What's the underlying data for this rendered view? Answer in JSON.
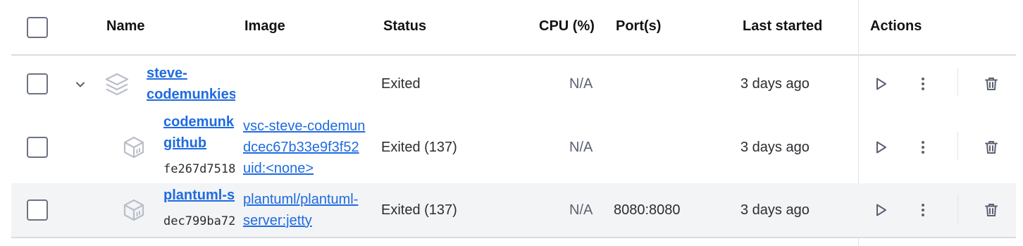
{
  "header": {
    "name": "Name",
    "image": "Image",
    "status": "Status",
    "cpu": "CPU (%)",
    "ports": "Port(s)",
    "last_started": "Last started",
    "actions": "Actions"
  },
  "rows": [
    {
      "name": "steve-codemunkies",
      "name_line1": "steve-",
      "name_line2": "codemunkies",
      "status": "Exited",
      "cpu": "N/A",
      "ports": "",
      "last_started": "3 days ago"
    },
    {
      "name_line1": "codemunk",
      "name_line2": "github",
      "id": "fe267d7518",
      "image_line1": "vsc-steve-codemun",
      "image_line2": "dcec67b33e9f3f52",
      "image_line3": "uid:<none>",
      "status": "Exited (137)",
      "cpu": "N/A",
      "ports": "",
      "last_started": "3 days ago"
    },
    {
      "name_line1": "plantuml-s",
      "id": "dec799ba72",
      "image_line1": "plantuml/plantuml-",
      "image_line2": "server:jetty",
      "status": "Exited (137)",
      "cpu": "N/A",
      "ports": "8080:8080",
      "last_started": "3 days ago"
    }
  ]
}
